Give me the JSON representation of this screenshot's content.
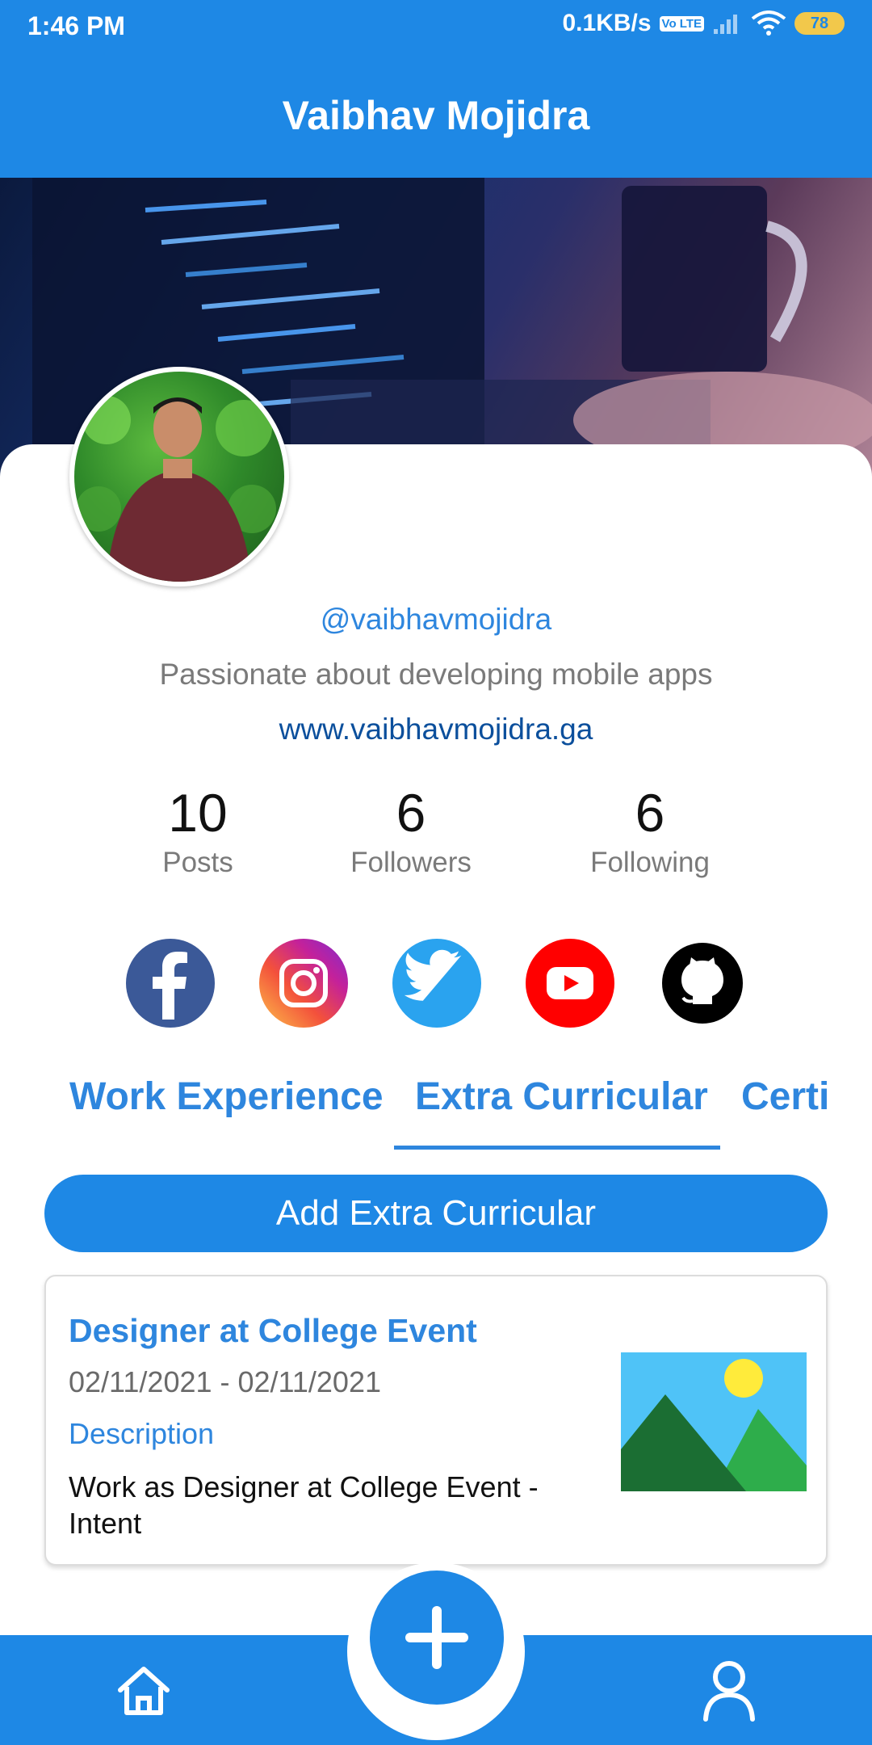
{
  "status_bar": {
    "time": "1:46 PM",
    "network_speed": "0.1KB/s",
    "lte_badge": "Vo LTE",
    "battery": "78"
  },
  "app_bar": {
    "title": "Vaibhav Mojidra"
  },
  "profile": {
    "username": "@vaibhavmojidra",
    "bio": "Passionate about developing mobile apps",
    "website": "www.vaibhavmojidra.ga",
    "stats": [
      {
        "value": "10",
        "label": "Posts"
      },
      {
        "value": "6",
        "label": "Followers"
      },
      {
        "value": "6",
        "label": "Following"
      }
    ],
    "social_icons": [
      "facebook-icon",
      "instagram-icon",
      "twitter-icon",
      "youtube-icon",
      "github-icon"
    ]
  },
  "tabs": [
    {
      "label": "Work Experience",
      "selected": false
    },
    {
      "label": "Extra Curricular",
      "selected": true
    },
    {
      "label": "Certi",
      "selected": false
    }
  ],
  "add_button": {
    "label": "Add Extra Curricular"
  },
  "entries": [
    {
      "title": "Designer at College Event",
      "date_range": "02/11/2021 - 02/11/2021",
      "description_label": "Description",
      "description": "Work as Designer at College Event - Intent"
    }
  ],
  "bottom_nav": {
    "items": [
      "home-icon",
      "add-icon",
      "profile-icon"
    ]
  },
  "colors": {
    "primary": "#1E88E5",
    "accent_text": "#2E86DE",
    "link": "#0B4F9C"
  }
}
